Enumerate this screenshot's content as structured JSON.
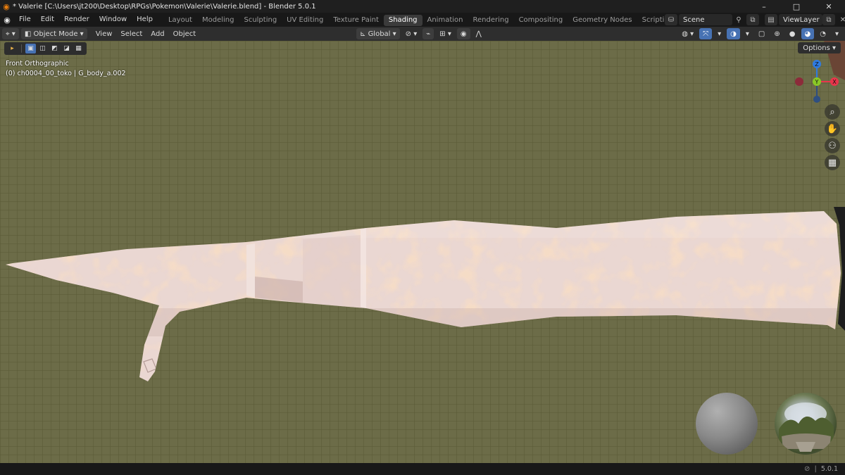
{
  "window": {
    "title": "* Valerie [C:\\Users\\jt200\\Desktop\\RPGs\\Pokemon\\Valerie\\Valerie.blend] - Blender 5.0.1",
    "minimize": "–",
    "maximize": "□",
    "close": "✕"
  },
  "menu": [
    "File",
    "Edit",
    "Render",
    "Window",
    "Help"
  ],
  "workspaces": [
    "Layout",
    "Modeling",
    "Sculpting",
    "UV Editing",
    "Texture Paint",
    "Shading",
    "Animation",
    "Rendering",
    "Compositing",
    "Geometry Nodes",
    "Scripting"
  ],
  "active_workspace": "Shading",
  "scene": {
    "name": "Scene",
    "view_layer": "ViewLayer"
  },
  "viewport_header": {
    "mode": "Object Mode",
    "menus": [
      "View",
      "Select",
      "Add",
      "Object"
    ],
    "orientation": "Global"
  },
  "viewport": {
    "view_name": "Front Orthographic",
    "object_info": "(0) ch0004_00_toko | G_body_a.002",
    "options_label": "Options"
  },
  "gizmo": {
    "z": "Z",
    "y": "Y",
    "x": "X"
  },
  "status": {
    "version": "5.0.1"
  },
  "colors": {
    "viewport_bg": "#6c6c48",
    "accent": "#4772b3",
    "axis_x": "#e8354b",
    "axis_y": "#8ac926",
    "axis_z": "#2f7be0"
  }
}
